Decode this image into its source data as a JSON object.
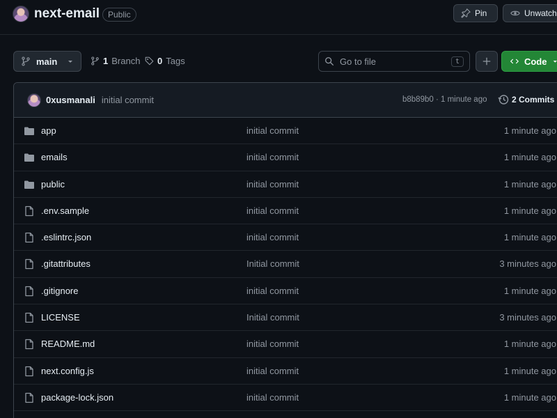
{
  "repo": {
    "name": "next-email",
    "visibility": "Public",
    "pin_label": "Pin",
    "watch_label": "Unwatch"
  },
  "toolbar": {
    "branch": "main",
    "branch_count": "1",
    "branch_label": "Branch",
    "tag_count": "0",
    "tag_label": "Tags",
    "search_placeholder": "Go to file",
    "search_shortcut": "t",
    "code_label": "Code"
  },
  "latest_commit": {
    "author": "0xusmanali",
    "message": "initial commit",
    "meta": "b8b89b0 · 1 minute ago",
    "commits_label": "2 Commits"
  },
  "files": [
    {
      "name": "app",
      "type": "folder",
      "commit": "initial commit",
      "age": "1 minute ago"
    },
    {
      "name": "emails",
      "type": "folder",
      "commit": "initial commit",
      "age": "1 minute ago"
    },
    {
      "name": "public",
      "type": "folder",
      "commit": "initial commit",
      "age": "1 minute ago"
    },
    {
      "name": ".env.sample",
      "type": "file",
      "commit": "initial commit",
      "age": "1 minute ago"
    },
    {
      "name": ".eslintrc.json",
      "type": "file",
      "commit": "initial commit",
      "age": "1 minute ago"
    },
    {
      "name": ".gitattributes",
      "type": "file",
      "commit": "Initial commit",
      "age": "3 minutes ago"
    },
    {
      "name": ".gitignore",
      "type": "file",
      "commit": "initial commit",
      "age": "1 minute ago"
    },
    {
      "name": "LICENSE",
      "type": "file",
      "commit": "Initial commit",
      "age": "3 minutes ago"
    },
    {
      "name": "README.md",
      "type": "file",
      "commit": "initial commit",
      "age": "1 minute ago"
    },
    {
      "name": "next.config.js",
      "type": "file",
      "commit": "initial commit",
      "age": "1 minute ago"
    },
    {
      "name": "package-lock.json",
      "type": "file",
      "commit": "initial commit",
      "age": "1 minute ago"
    }
  ],
  "colors": {
    "background": "#0d1117",
    "code_button": "#238636",
    "folder_icon": "#9198a1"
  }
}
